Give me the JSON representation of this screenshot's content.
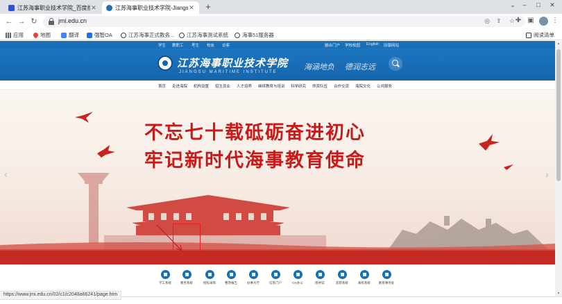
{
  "browser": {
    "tabs": [
      {
        "title": "江苏海事职业技术学院_百度搜索",
        "active": false
      },
      {
        "title": "江苏海事职业技术学院-Jiangsu",
        "active": true
      }
    ],
    "new_tab": "+",
    "window_controls": {
      "minimize": "–",
      "maximize": "□",
      "close": "✕"
    },
    "nav": {
      "back": "←",
      "forward": "→",
      "reload": "↻"
    },
    "url": "jmi.edu.cn",
    "bookmarks": [
      "应用",
      "地图",
      "翻译",
      "强智OA",
      "江苏海事正式教务...",
      "江苏海事测试系统",
      "海事51服务器"
    ],
    "reading_list": "阅读清单",
    "status_url": "https://www.jmi.edu.cn/02/c1/c2048a66241/page.htm"
  },
  "site": {
    "top_links_left": [
      "学生",
      "教职工",
      "考生",
      "校友",
      "访客"
    ],
    "top_links_right": [
      "融合门户",
      "学校校园",
      "English",
      "旧版网站"
    ],
    "school_name_cn": "江苏海事职业技术学院",
    "school_name_en": "JIANGSU MARITIME INSTITUTE",
    "motto": [
      "海涵地负",
      "德润志远"
    ],
    "main_nav": [
      "首页",
      "走进海院",
      "机构设置",
      "招生就业",
      "人才培养",
      "继续教育与培训",
      "科学研究",
      "师资队伍",
      "合作交流",
      "海院文化",
      "公共服务"
    ],
    "banner": {
      "line1": "不忘七十载砥砺奋进初心",
      "line2": "牢记新时代海事教育使命"
    },
    "quick_links": [
      "学工系统",
      "教务系统",
      "招标采购",
      "整改报告",
      "办事大厅",
      "信息门户",
      "OA办公",
      "图书馆",
      "迎新系统",
      "离校系统",
      "教育事务处"
    ],
    "colors": {
      "brand_blue": "#1565ad",
      "slogan_red": "#c91a1a",
      "highlight_red": "#e02020"
    }
  }
}
